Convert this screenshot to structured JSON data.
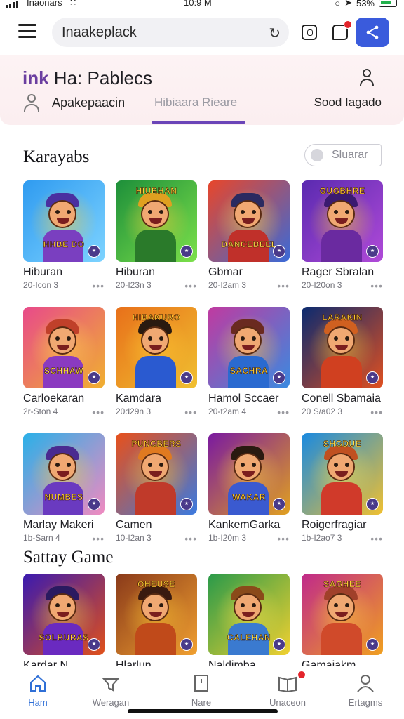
{
  "status_bar": {
    "carrier": "Inaonars",
    "time": "10:9 M",
    "battery": "53%"
  },
  "topbar": {
    "search_value": "Inaakeplack",
    "search_placeholder": "",
    "share_color": "#3a5bdc",
    "chat_badge": true
  },
  "hero": {
    "title_accent": "ink",
    "title_rest": " Ha: Pablecs",
    "tabs": [
      "Apakepaacin",
      "Hibiaara Rieare",
      "Sood Iagado"
    ],
    "active_tab": 1
  },
  "sections": [
    {
      "title": "Karayabs",
      "filter_label": "Sluarar",
      "games": [
        {
          "name": "Hiburan",
          "meta": "20-Icon 3",
          "banner": "HHBE DO",
          "bg": [
            "#2f9bf0",
            "#7dd3ff"
          ],
          "accent": "#ffd23a",
          "body": "#7a3fc0",
          "hair": "#4a2fa0"
        },
        {
          "name": "Hiburan",
          "meta": "20-I23n 3",
          "banner": "HIUBHAN",
          "bg": [
            "#1d8f3a",
            "#7ce04a"
          ],
          "accent": "#ffd23a",
          "body": "#2a7a2a",
          "hair": "#e0a020"
        },
        {
          "name": "Gbmar",
          "meta": "20-I2am 3",
          "banner": "DANCEBEEL",
          "bg": [
            "#e8462a",
            "#3a6ad8"
          ],
          "accent": "#ffe04a",
          "body": "#c0302a",
          "hair": "#2a2a60"
        },
        {
          "name": "Rager Sbralan",
          "meta": "20-I20on 3",
          "banner": "GUGBHRE",
          "bg": [
            "#5a2ab0",
            "#b04ad8"
          ],
          "accent": "#ffcc33",
          "body": "#6a2aa0",
          "hair": "#3a1a70"
        }
      ]
    },
    {
      "title": "",
      "filter_label": "",
      "games": [
        {
          "name": "Carloekaran",
          "meta": "2r-Ston 4",
          "banner": "SCHHAW",
          "bg": [
            "#e84a8a",
            "#f0b030"
          ],
          "accent": "#ffe04a",
          "body": "#8a3ac0",
          "hair": "#c0402a"
        },
        {
          "name": "Kamdara",
          "meta": "20d29n 3",
          "banner": "HIBAKURO",
          "bg": [
            "#e8701a",
            "#f0c030"
          ],
          "accent": "#ffcc33",
          "body": "#2a5ad0",
          "hair": "#2a1a10"
        },
        {
          "name": "Hamol Sccaer",
          "meta": "20-t2am 4",
          "banner": "SACHRA",
          "bg": [
            "#c03aa0",
            "#3a8ae0"
          ],
          "accent": "#ffd23a",
          "body": "#2a6ad0",
          "hair": "#6a2a20"
        },
        {
          "name": "Conell Sbamaia",
          "meta": "20 S/a02 3",
          "banner": "LARAKIN",
          "bg": [
            "#0a2a70",
            "#e05020"
          ],
          "accent": "#ffcc33",
          "body": "#d04020",
          "hair": "#d06020"
        }
      ]
    },
    {
      "title": "",
      "filter_label": "",
      "games": [
        {
          "name": "Marlay Makeri",
          "meta": "1b-Sarn 4",
          "banner": "NUMBES",
          "bg": [
            "#2ab0e8",
            "#f08ac0"
          ],
          "accent": "#ffd23a",
          "body": "#6a3ac0",
          "hair": "#4a2a90"
        },
        {
          "name": "Camen",
          "meta": "10-I2an 3",
          "banner": "PUNCBERS",
          "bg": [
            "#e8501a",
            "#3a7ae0"
          ],
          "accent": "#ffcc33",
          "body": "#c03a2a",
          "hair": "#e07a20"
        },
        {
          "name": "KankemGarka",
          "meta": "1b-I20m 3",
          "banner": "WAKAR",
          "bg": [
            "#7a1aa0",
            "#e0a020"
          ],
          "accent": "#ffd23a",
          "body": "#3a5ad0",
          "hair": "#2a1a10"
        },
        {
          "name": "Roigerfragiar",
          "meta": "1b-I2ao7 3",
          "banner": "SHGDUE",
          "bg": [
            "#1a8ae0",
            "#f0c030"
          ],
          "accent": "#ffe04a",
          "body": "#d03a2a",
          "hair": "#c05020"
        }
      ]
    },
    {
      "title": "Sattay Game",
      "filter_label": "",
      "games": [
        {
          "name": "Kardar N",
          "meta": "",
          "banner": "SOLBUBAS",
          "bg": [
            "#3a1ab0",
            "#e0501a"
          ],
          "accent": "#ffd23a",
          "body": "#6a2ac0",
          "hair": "#2a1a60"
        },
        {
          "name": "Hlarlun",
          "meta": "",
          "banner": "OHEUSE",
          "bg": [
            "#8a3a1a",
            "#f0a030"
          ],
          "accent": "#ffcc33",
          "body": "#c04a1a",
          "hair": "#3a1a10"
        },
        {
          "name": "Naldimba",
          "meta": "",
          "banner": "CALEHAN",
          "bg": [
            "#2a9a4a",
            "#f0d030"
          ],
          "accent": "#ffe04a",
          "body": "#3a7ad0",
          "hair": "#8a4a1a"
        },
        {
          "name": "Gamaiakm",
          "meta": "",
          "banner": "SAGHEE",
          "bg": [
            "#c02a8a",
            "#f0a020"
          ],
          "accent": "#ffd23a",
          "body": "#d04a2a",
          "hair": "#a0402a"
        }
      ]
    }
  ],
  "bottom_nav": [
    {
      "label": "Ham",
      "icon": "home-icon",
      "active": true
    },
    {
      "label": "Weragan",
      "icon": "discover-icon",
      "active": false
    },
    {
      "label": "Nare",
      "icon": "bookmark-icon",
      "active": false
    },
    {
      "label": "Unaceon",
      "icon": "library-icon",
      "active": false,
      "badge": true
    },
    {
      "label": "Ertagms",
      "icon": "profile-icon",
      "active": false
    }
  ]
}
